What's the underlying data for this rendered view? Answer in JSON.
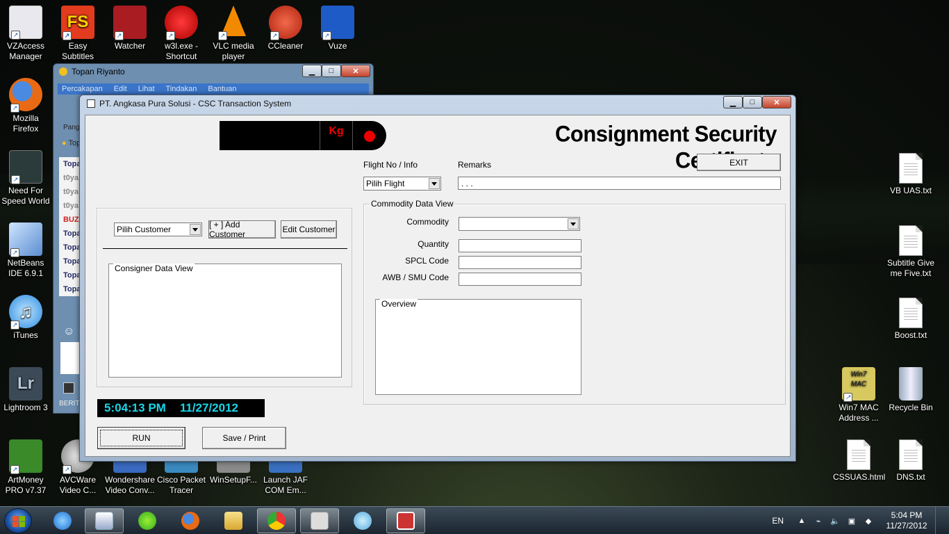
{
  "desktop_left_icons": [
    {
      "label": "VZAccess Manager",
      "color": "#e8e8ee"
    },
    {
      "label": "Easy Subtitles Synchronizer",
      "color": "#e23b1e"
    },
    {
      "label": "Watcher",
      "color": "#a81c22"
    },
    {
      "label": "w3l.exe - Shortcut",
      "color": "#d41414"
    },
    {
      "label": "VLC media player",
      "color": "#f28a00"
    },
    {
      "label": "CCleaner",
      "color": "#d33a2a"
    },
    {
      "label": "Vuze",
      "color": "#1e5bc6"
    },
    {
      "label": "Mozilla Firefox",
      "color": "#e86a14"
    },
    {
      "label": "Need For Speed World",
      "color": "#2b3b3b"
    },
    {
      "label": "NetBeans IDE 6.9.1",
      "color": "#7fb0e0"
    },
    {
      "label": "iTunes",
      "color": "#3aa0e8"
    },
    {
      "label": "Lightroom 3",
      "color": "#3c4a58"
    },
    {
      "label": "ArtMoney PRO v7.37",
      "color": "#3a8a2a"
    },
    {
      "label": "AVCWare Video C...",
      "color": "#b0b0b0"
    },
    {
      "label": "Wondershare Video Conv...",
      "color": "#3a6ac0"
    },
    {
      "label": "Cisco Packet Tracer",
      "color": "#3a8ac0"
    },
    {
      "label": "WinSetupF...",
      "color": "#8a8a8a"
    },
    {
      "label": "Launch JAF COM Em...",
      "color": "#3a70c0"
    }
  ],
  "desktop_right_icons": [
    {
      "label": "VB UAS.txt"
    },
    {
      "label": "Subtitle Give me Five.txt"
    },
    {
      "label": "Boost.txt"
    },
    {
      "label": "Win7 MAC Address ..."
    },
    {
      "label": "Recycle Bin"
    },
    {
      "label": "CSSUAS.html"
    },
    {
      "label": "DNS.txt"
    }
  ],
  "chat_window": {
    "title": "Topan Riyanto",
    "menu": [
      "Percakapan",
      "Edit",
      "Lihat",
      "Tindakan",
      "Bantuan"
    ],
    "side_items": [
      "Pang",
      "Top",
      "Topa",
      "t0ya",
      "t0ya",
      "t0ya",
      "BUZ",
      "Topa",
      "Topa",
      "Topa",
      "Topa",
      "Topa",
      "BERIT"
    ]
  },
  "app": {
    "title": "PT. Angkasa Pura Solusi - CSC Transaction System",
    "kg_label": "Kg",
    "heading": "Consignment Security Certificate",
    "exit_label": "EXIT",
    "flight_label": "Flight No / Info",
    "flight_value": "Pilih Flight",
    "remarks_label": "Remarks",
    "remarks_value": ". . .",
    "customer_value": "Pilih Customer",
    "add_customer_label": "[ + ] Add Customer",
    "edit_customer_label": "Edit Customer",
    "consigner_label": "Consigner Data View",
    "commodity_group_label": "Commodity Data View",
    "commodity_label": "Commodity",
    "quantity_label": "Quantity",
    "spcl_label": "SPCL Code",
    "awb_label": "AWB / SMU Code",
    "overview_label": "Overview",
    "clock_time": "5:04:13 PM",
    "clock_date": "11/27/2012",
    "run_label": "RUN",
    "save_label": "Save / Print"
  },
  "taskbar": {
    "language": "EN",
    "time": "5:04 PM",
    "date": "11/27/2012",
    "pinned": [
      "internet-explorer",
      "windows-media-player",
      "cut-the-rope",
      "firefox",
      "file-explorer",
      "chrome",
      "snipping",
      "msn-messenger",
      "access-app"
    ]
  }
}
